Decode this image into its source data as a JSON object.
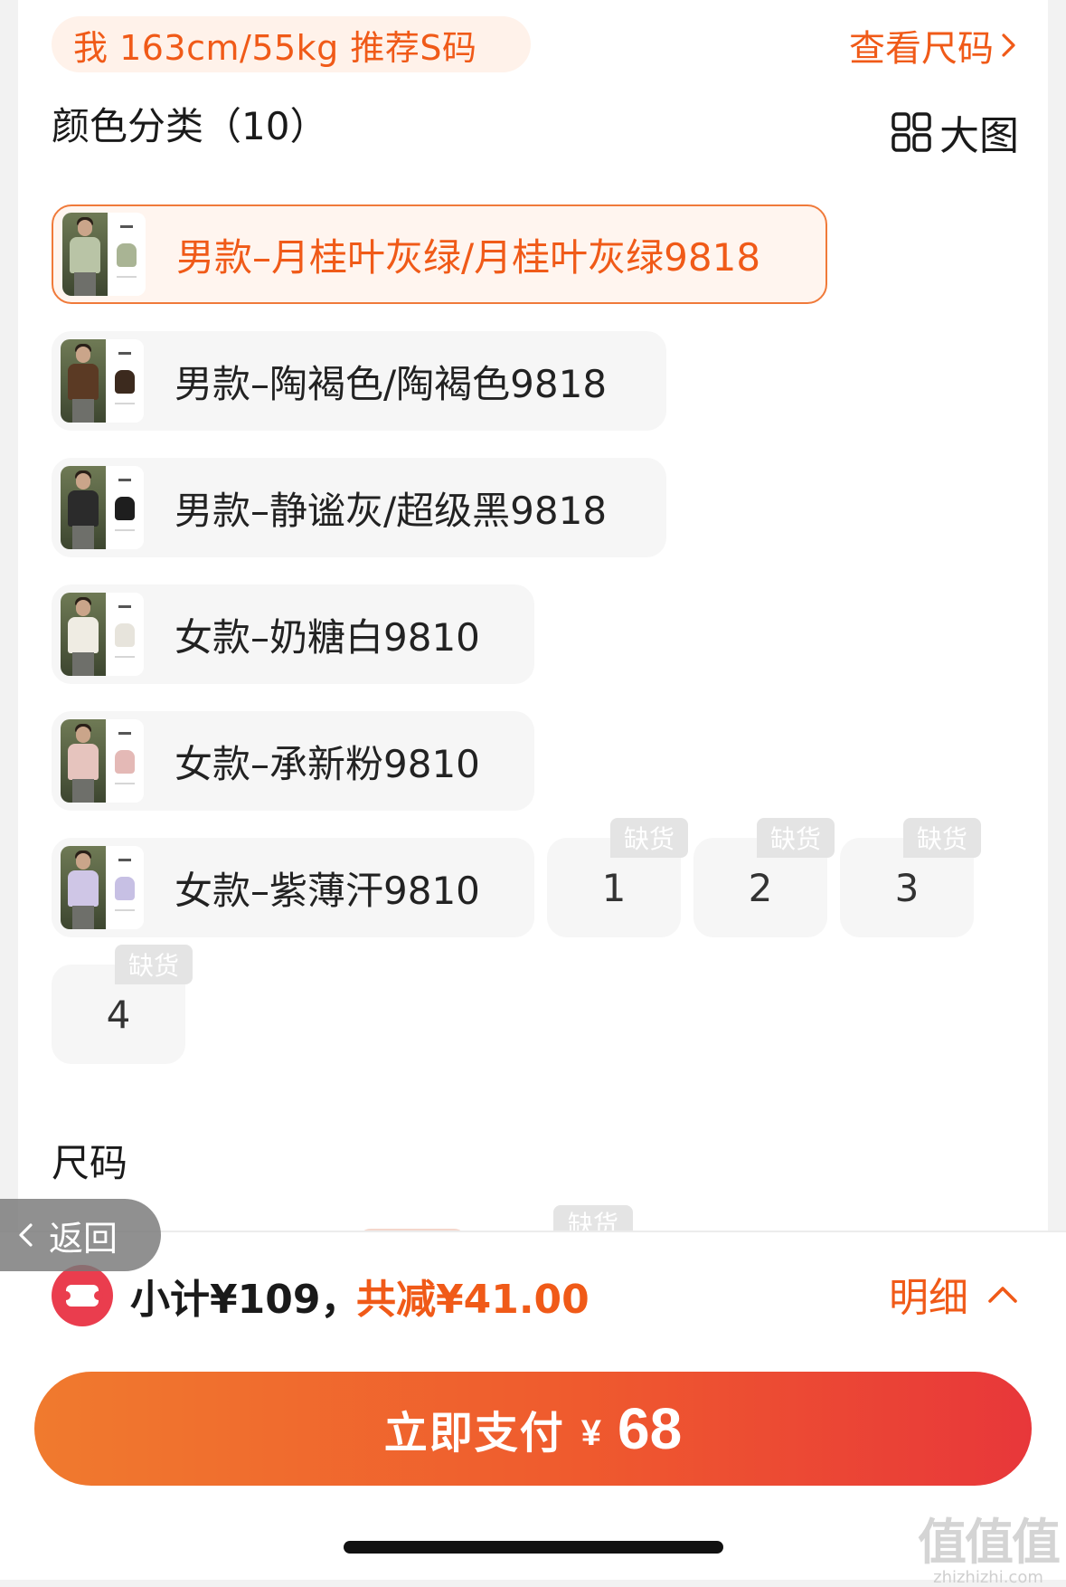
{
  "recommendation": {
    "text": "我 163cm/55kg 推荐S码",
    "size_chart_label": "查看尺码"
  },
  "color_section": {
    "title": "颜色分类（10）",
    "big_view_label": "大图"
  },
  "color_options": [
    {
      "label": "男款–月桂叶灰绿/月桂叶灰绿9818",
      "selected": true,
      "garment_color": "#b9c4a6",
      "swatch": "#a9b494"
    },
    {
      "label": "男款–陶褐色/陶褐色9818",
      "selected": false,
      "garment_color": "#5b3a24",
      "swatch": "#3c2a1e"
    },
    {
      "label": "男款–静谧灰/超级黑9818",
      "selected": false,
      "garment_color": "#2b2b2b",
      "swatch": "#1e1e1e"
    },
    {
      "label": "女款–奶糖白9810",
      "selected": false,
      "garment_color": "#efece3",
      "swatch": "#e7e4dc"
    },
    {
      "label": "女款–承新粉9810",
      "selected": false,
      "garment_color": "#e6c4be",
      "swatch": "#e4b9b6"
    },
    {
      "label": "女款–紫薄汗9810",
      "selected": false,
      "garment_color": "#cfc6e6",
      "swatch": "#c7c0e4"
    }
  ],
  "number_options": [
    {
      "label": "1",
      "badge": "缺货"
    },
    {
      "label": "2",
      "badge": "缺货"
    },
    {
      "label": "3",
      "badge": "缺货"
    },
    {
      "label": "4",
      "badge": "缺货"
    }
  ],
  "size_section": {
    "title": "尺码",
    "peek_badge": "缺货"
  },
  "back_button": {
    "label": "返回"
  },
  "bottom_bar": {
    "subtotal": "小计¥109，",
    "discount": "共减¥41.00",
    "details_label": "明细",
    "pay_label": "立即支付",
    "pay_currency": "¥",
    "pay_amount": "68"
  },
  "watermark": {
    "logo": "值值值",
    "url": "zhizhizhi.com"
  },
  "colors": {
    "accent": "#f05a18",
    "pay_gradient_start": "#f07a2e",
    "pay_gradient_end": "#e8373a",
    "coupon_red": "#ea3d4e"
  }
}
